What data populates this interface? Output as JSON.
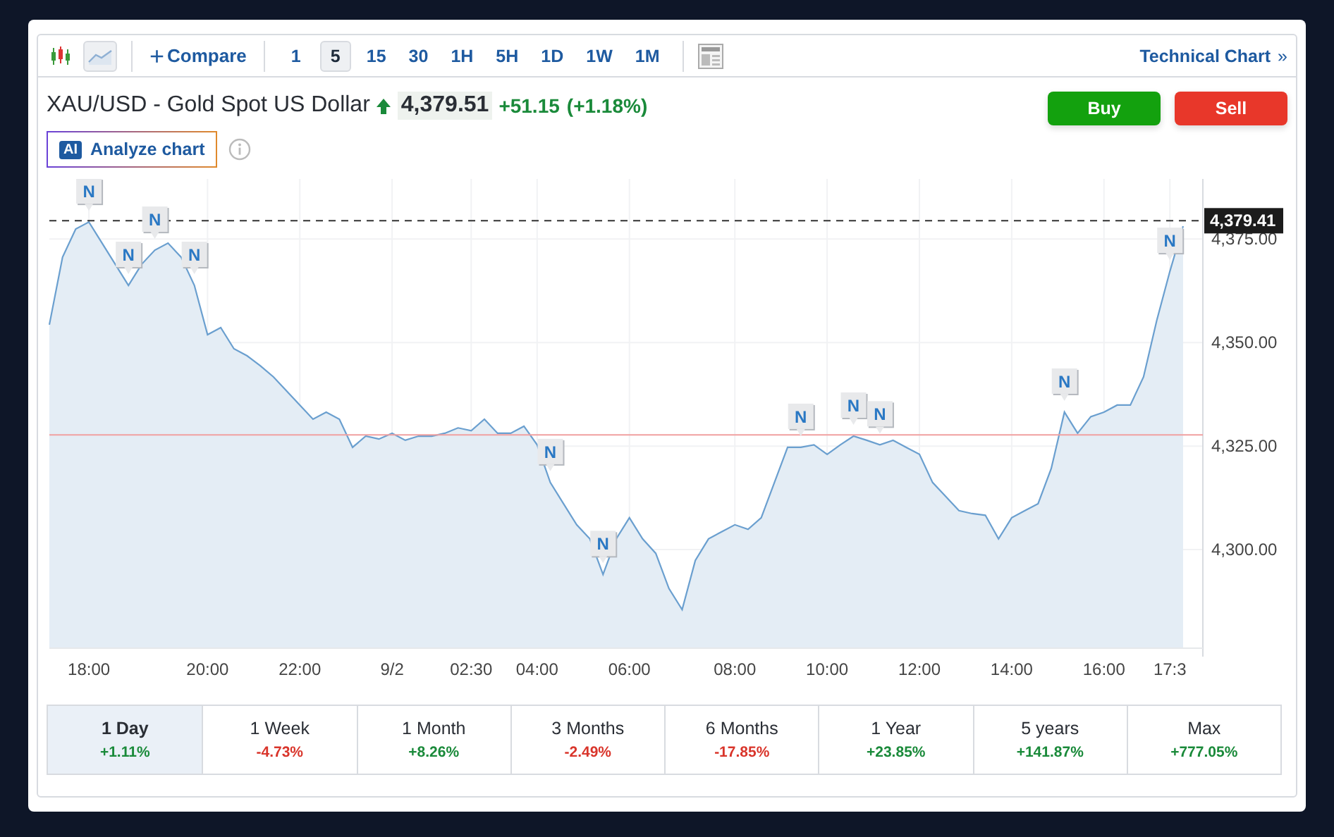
{
  "toolbar": {
    "chart_types": [
      {
        "kind": "candles",
        "selected": false
      },
      {
        "kind": "area",
        "selected": true
      }
    ],
    "compare": {
      "icon": "+",
      "label": "Compare"
    },
    "intervals": [
      {
        "label": "1",
        "selected": false
      },
      {
        "label": "5",
        "selected": true
      },
      {
        "label": "15",
        "selected": false
      },
      {
        "label": "30",
        "selected": false
      },
      {
        "label": "1H",
        "selected": false
      },
      {
        "label": "5H",
        "selected": false
      },
      {
        "label": "1D",
        "selected": false
      },
      {
        "label": "1W",
        "selected": false
      },
      {
        "label": "1M",
        "selected": false
      }
    ],
    "technical_chart": {
      "label": "Technical Chart",
      "icon": "»"
    }
  },
  "instrument": {
    "title": "XAU/USD - Gold Spot US Dollar",
    "rising": true,
    "price": "4,379.51",
    "change": "+51.15",
    "change_percent": "(+1.18%)"
  },
  "actions": [
    {
      "kind": "buy",
      "label": "Buy"
    },
    {
      "kind": "sell",
      "label": "Sell"
    }
  ],
  "analyze": {
    "badge": "AI",
    "label": "Analyze chart"
  },
  "chart_data": {
    "type": "area",
    "grid": true,
    "ylim": [
      4276.2,
      4389.5
    ],
    "yticks": [
      {
        "value": 4300,
        "label": "4,300.00"
      },
      {
        "value": 4325,
        "label": "4,325.00"
      },
      {
        "value": 4350,
        "label": "4,350.00"
      },
      {
        "value": 4375,
        "label": "4,375.00"
      }
    ],
    "categories": [
      null,
      null,
      null,
      "18:00",
      null,
      null,
      null,
      null,
      null,
      null,
      null,
      null,
      "20:00",
      null,
      null,
      null,
      null,
      null,
      null,
      "22:00",
      null,
      null,
      null,
      null,
      null,
      null,
      "9/2",
      null,
      null,
      null,
      null,
      null,
      "02:30",
      null,
      null,
      null,
      null,
      "04:00",
      null,
      null,
      null,
      null,
      null,
      null,
      "06:00",
      null,
      null,
      null,
      null,
      null,
      null,
      null,
      "08:00",
      null,
      null,
      null,
      null,
      null,
      null,
      "10:00",
      null,
      null,
      null,
      null,
      null,
      null,
      "12:00",
      null,
      null,
      null,
      null,
      null,
      null,
      "14:00",
      null,
      null,
      null,
      null,
      null,
      null,
      "16:00",
      null,
      null,
      null,
      null,
      "17:3",
      null
    ],
    "series": [
      {
        "color": "#6a9fcf",
        "values": [
          4354.3,
          4370.6,
          4377.4,
          4379.1,
          4374.0,
          4368.9,
          4363.8,
          4368.9,
          4372.3,
          4374.0,
          4370.6,
          4363.8,
          4351.9,
          4353.6,
          4348.5,
          4346.8,
          4344.4,
          4341.7,
          4338.3,
          4334.9,
          4331.5,
          4333.2,
          4331.5,
          4324.7,
          4327.4,
          4326.7,
          4328.1,
          4326.4,
          4327.4,
          4327.4,
          4328.1,
          4329.4,
          4328.7,
          4331.5,
          4328.1,
          4328.1,
          4329.8,
          4325.3,
          4316.2,
          4311.1,
          4306.0,
          4302.6,
          4294.0,
          4302.6,
          4307.7,
          4302.6,
          4299.1,
          4290.6,
          4285.5,
          4297.4,
          4302.6,
          4304.3,
          4306.0,
          4304.9,
          4307.7,
          4316.2,
          4324.7,
          4324.7,
          4325.3,
          4323.0,
          4325.3,
          4327.4,
          4326.4,
          4325.3,
          4326.4,
          4324.7,
          4323.0,
          4316.2,
          4312.8,
          4309.4,
          4308.7,
          4308.3,
          4302.6,
          4307.7,
          4309.4,
          4311.1,
          4319.6,
          4333.2,
          4328.1,
          4332.1,
          4333.2,
          4334.9,
          4334.9,
          4341.7,
          4355.3,
          4367.2,
          4378.1
        ]
      }
    ],
    "ref_lines": [
      {
        "axis": "y",
        "value": 4379.41,
        "label": "4,379.41"
      },
      {
        "axis": "y",
        "value": 4327.7
      }
    ]
  },
  "news_flags": [
    {
      "label": "N"
    },
    {
      "label": "N"
    },
    {
      "label": "N"
    },
    {
      "label": "N"
    },
    {
      "label": "N"
    },
    {
      "label": "N"
    },
    {
      "label": "N"
    },
    {
      "label": "N"
    },
    {
      "label": "N"
    },
    {
      "label": "N"
    },
    {
      "label": "N"
    }
  ],
  "periods": [
    {
      "label": "1 Day",
      "change": "+1.11%",
      "color": "#1a8a3a",
      "selected": true
    },
    {
      "label": "1 Week",
      "change": "-4.73%",
      "color": "#d9352b",
      "selected": false
    },
    {
      "label": "1 Month",
      "change": "+8.26%",
      "color": "#1a8a3a",
      "selected": false
    },
    {
      "label": "3 Months",
      "change": "-2.49%",
      "color": "#d9352b",
      "selected": false
    },
    {
      "label": "6 Months",
      "change": "-17.85%",
      "color": "#d9352b",
      "selected": false
    },
    {
      "label": "1 Year",
      "change": "+23.85%",
      "color": "#1a8a3a",
      "selected": false
    },
    {
      "label": "5 years",
      "change": "+141.87%",
      "color": "#1a8a3a",
      "selected": false
    },
    {
      "label": "Max",
      "change": "+777.05%",
      "color": "#1a8a3a",
      "selected": false
    }
  ]
}
